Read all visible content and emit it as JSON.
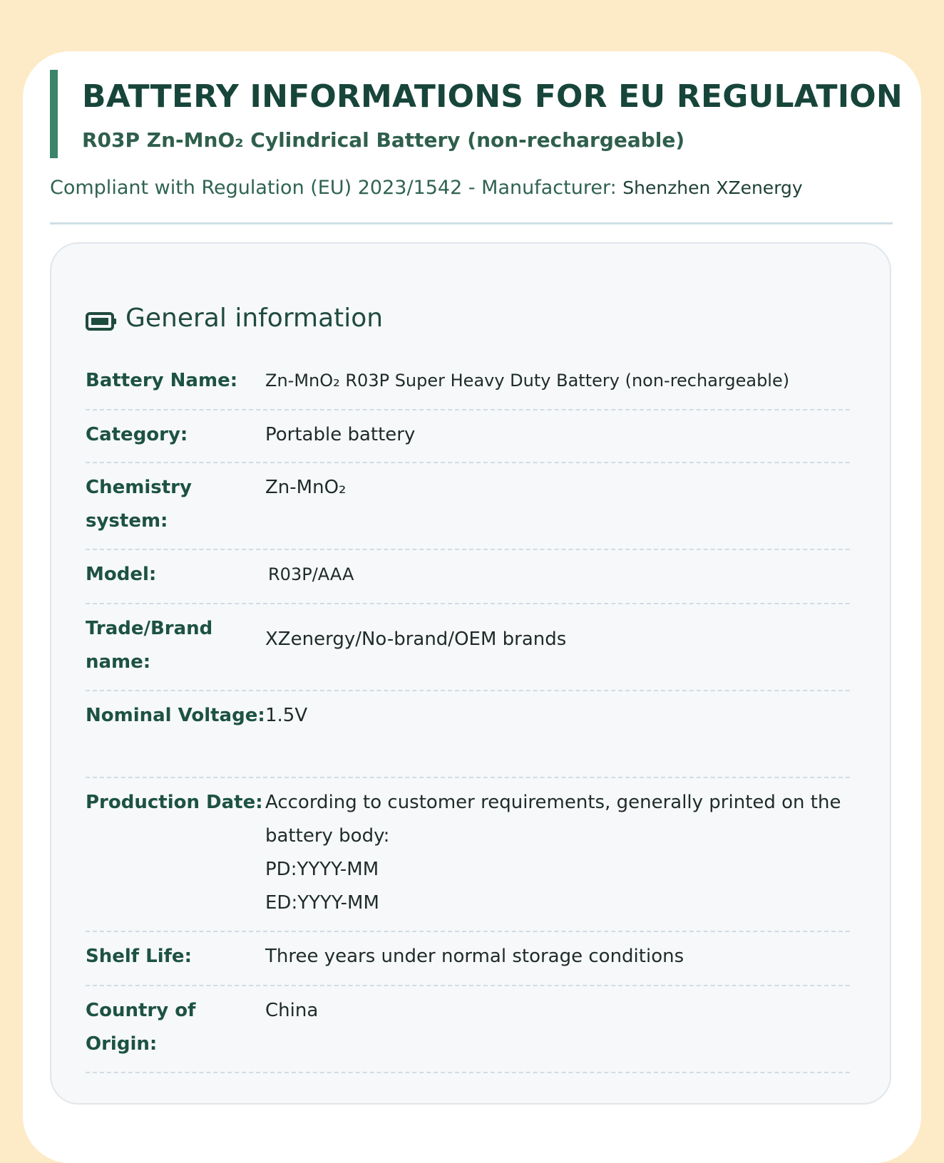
{
  "header": {
    "title": "BATTERY INFORMATIONS FOR EU REGULATION",
    "subtitle": "R03P Zn-MnO₂ Cylindrical Battery (non-rechargeable)",
    "compliance_text": "Compliant with Regulation (EU) 2023/1542 - Manufacturer: ",
    "manufacturer": "Shenzhen XZenergy"
  },
  "colors": {
    "page_background": "#fdebc8",
    "accent_green": "#3b8469",
    "heading_green": "#17453a"
  },
  "general_info": {
    "icon": "battery-icon",
    "heading": "General information",
    "rows": [
      {
        "label": "Battery Name:",
        "value": "Zn-MnO₂ R03P Super Heavy Duty Battery (non-rechargeable)"
      },
      {
        "label": "Category:",
        "value": "Portable battery"
      },
      {
        "label": "Chemistry system:",
        "value": "Zn-MnO₂"
      },
      {
        "label": "Model:",
        "value": "R03P/AAA"
      },
      {
        "label": "Trade/Brand name:",
        "value": "XZenergy/No-brand/OEM brands"
      },
      {
        "label": "Nominal Voltage:",
        "value": "1.5V"
      },
      {
        "label": "Production Date:",
        "value": "According to customer requirements, generally printed on the battery body:\nPD:YYYY-MM\nED:YYYY-MM"
      },
      {
        "label": "Shelf Life:",
        "value": "Three years under normal storage conditions"
      },
      {
        "label": "Country of Origin:",
        "value": "China"
      }
    ]
  }
}
